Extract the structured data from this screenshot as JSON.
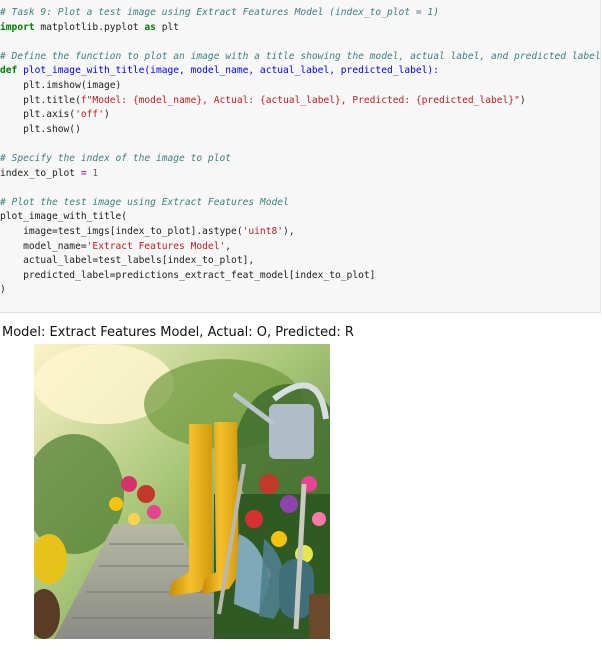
{
  "code_cell": {
    "lines": {
      "l1": "# Task 9: Plot a test image using Extract Features Model (index_to_plot = 1)",
      "l2_kw1": "import",
      "l2_mod": " matplotlib.pyplot ",
      "l2_kw2": "as",
      "l2_name": " plt",
      "l4": "# Define the function to plot an image with a title showing the model, actual label, and predicted label",
      "l5_kw": "def",
      "l5_sig": " plot_image_with_title(image, model_name, actual_label, predicted_label):",
      "l6": "    plt.imshow(image)",
      "l7_pre": "    plt.title(",
      "l7_str": "f\"Model: {model_name}, Actual: {actual_label}, Predicted: {predicted_label}\"",
      "l7_post": ")",
      "l8_pre": "    plt.axis(",
      "l8_str": "'off'",
      "l8_post": ")",
      "l9": "    plt.show()",
      "l11": "# Specify the index of the image to plot",
      "l12_name": "index_to_plot ",
      "l12_op": "=",
      "l12_num": " 1",
      "l14": "# Plot the test image using Extract Features Model",
      "l15": "plot_image_with_title(",
      "l16_pre": "    image=test_imgs[index_to_plot].astype(",
      "l16_str": "'uint8'",
      "l16_post": "),",
      "l17_pre": "    model_name=",
      "l17_str": "'Extract Features Model'",
      "l17_post": ",",
      "l18": "    actual_label=test_labels[index_to_plot],",
      "l19": "    predicted_label=predictions_extract_feat_model[index_to_plot]",
      "l20": ")"
    }
  },
  "output": {
    "plot_title": "Model: Extract Features Model, Actual: O, Predicted: R",
    "image_icon": "garden-photo-icon"
  }
}
